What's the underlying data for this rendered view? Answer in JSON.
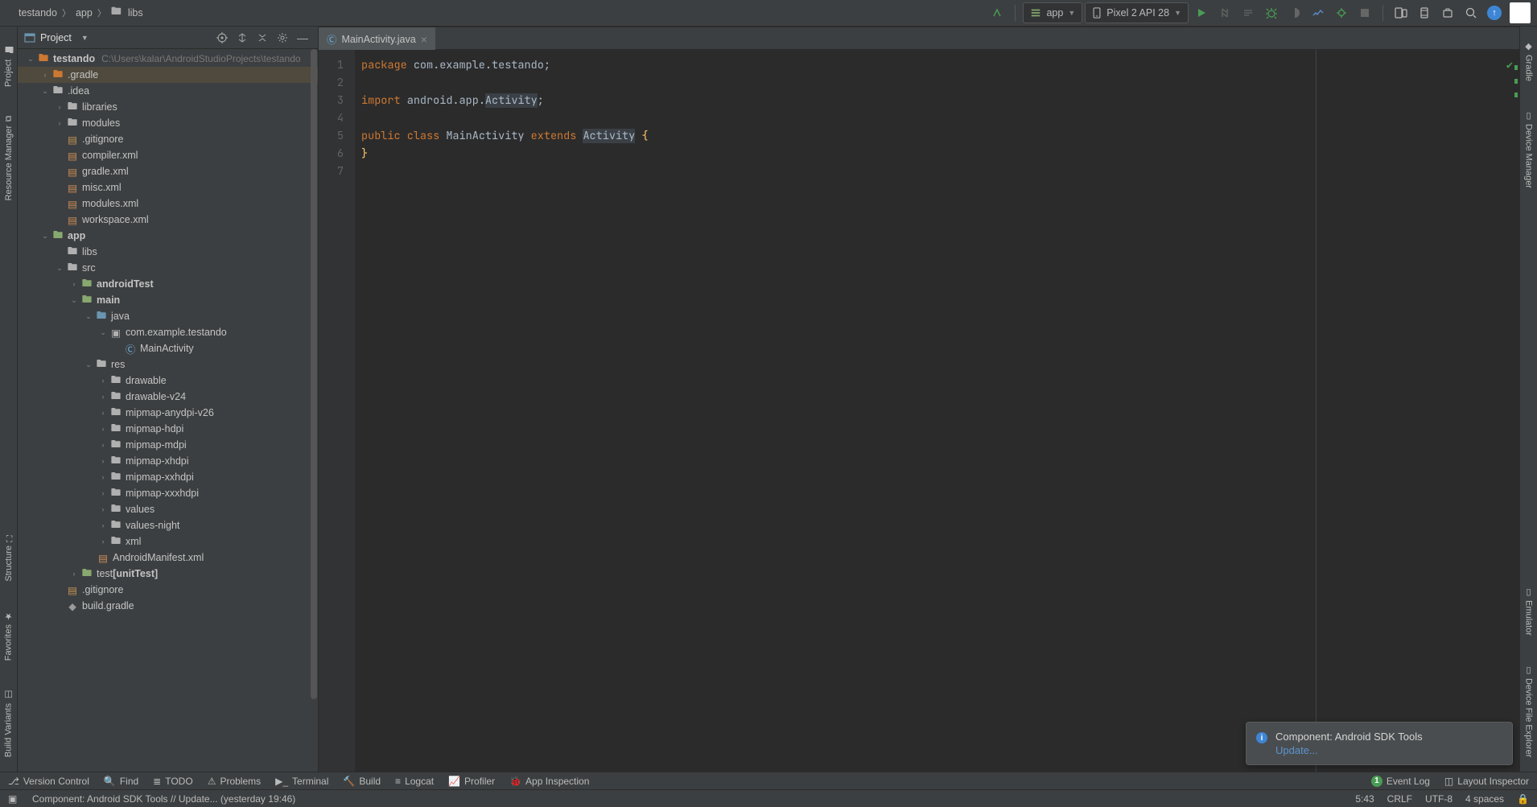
{
  "breadcrumb": {
    "a": "testando",
    "b": "app",
    "c": "libs"
  },
  "toolbar": {
    "module": "app",
    "device": "Pixel 2 API 28"
  },
  "project": {
    "title": "Project",
    "root": {
      "name": "testando",
      "path": "C:\\Users\\kalar\\AndroidStudioProjects\\testando"
    },
    "items": {
      "gradle": ".gradle",
      "idea": ".idea",
      "libraries": "libraries",
      "modules": "modules",
      "gitignore_idea": ".gitignore",
      "compilerxml": "compiler.xml",
      "gradlexml": "gradle.xml",
      "miscxml": "misc.xml",
      "modulesxml": "modules.xml",
      "workspacexml": "workspace.xml",
      "app": "app",
      "libs": "libs",
      "src": "src",
      "androidTest": "androidTest",
      "main": "main",
      "java": "java",
      "pkg": "com.example.testando",
      "mainActivity": "MainActivity",
      "res": "res",
      "drawable": "drawable",
      "drawablev24": "drawable-v24",
      "mipmap_anydpi": "mipmap-anydpi-v26",
      "mipmap_hdpi": "mipmap-hdpi",
      "mipmap_mdpi": "mipmap-mdpi",
      "mipmap_xhdpi": "mipmap-xhdpi",
      "mipmap_xxhdpi": "mipmap-xxhdpi",
      "mipmap_xxxhdpi": "mipmap-xxxhdpi",
      "values": "values",
      "values_night": "values-night",
      "xml": "xml",
      "manifest": "AndroidManifest.xml",
      "test_unit": "test",
      "test_unit_suffix": "[unitTest]",
      "gitignore_app": ".gitignore",
      "buildgradle": "build.gradle"
    }
  },
  "editor": {
    "tab": "MainActivity.java",
    "lines": [
      "1",
      "2",
      "3",
      "4",
      "5",
      "6",
      "7"
    ],
    "code": {
      "l1_kw": "package",
      "l1_pkg": "com.example.testando",
      "semi": ";",
      "l3_kw": "import",
      "l3_pkg": "android.app.",
      "l3_cls": "Activity",
      "l5_pub": "public",
      "l5_cls": "class",
      "l5_name": "MainActivity",
      "l5_ext": "extends",
      "l5_act": "Activity",
      "l5_ob": "{",
      "l6_cb": "}"
    }
  },
  "popup": {
    "title": "Component: Android SDK Tools",
    "link": "Update..."
  },
  "bottom": {
    "vc": "Version Control",
    "find": "Find",
    "todo": "TODO",
    "problems": "Problems",
    "terminal": "Terminal",
    "build": "Build",
    "logcat": "Logcat",
    "profiler": "Profiler",
    "appinspect": "App Inspection",
    "eventlog": "Event Log",
    "layoutinspect": "Layout Inspector"
  },
  "status": {
    "msg": "Component: Android SDK Tools // Update... (yesterday 19:46)",
    "pos": "5:43",
    "sep": "CRLF",
    "enc": "UTF-8",
    "indent": "4 spaces"
  },
  "sidetabs": {
    "project": "Project",
    "resmgr": "Resource Manager",
    "structure": "Structure",
    "favorites": "Favorites",
    "buildvar": "Build Variants",
    "gradle": "Gradle",
    "devmgr": "Device Manager",
    "emulator": "Emulator",
    "devfile": "Device File Explorer"
  }
}
